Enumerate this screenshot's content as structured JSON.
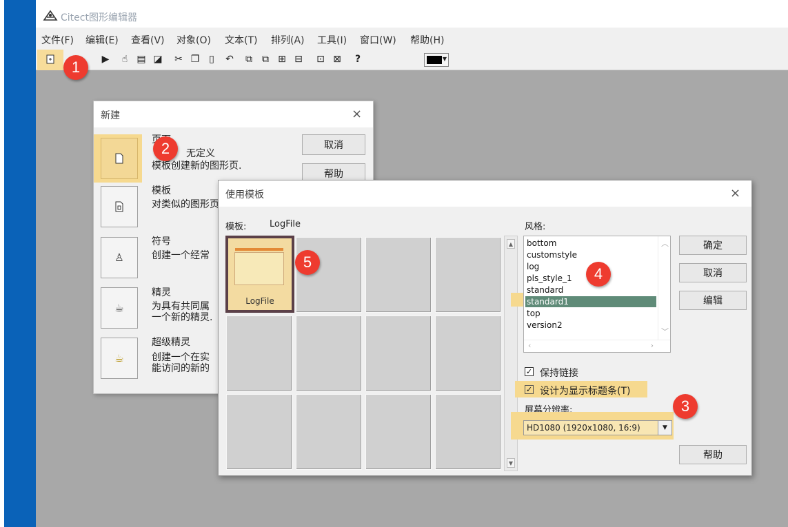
{
  "app": {
    "title": "Citect图形编辑器",
    "menu": [
      "文件(F)",
      "编辑(E)",
      "查看(V)",
      "对象(O)",
      "文本(T)",
      "排列(A)",
      "工具(I)",
      "窗口(W)",
      "帮助(H)"
    ],
    "toolbar_help_glyph": "?"
  },
  "badges": [
    "1",
    "2",
    "3",
    "4",
    "5"
  ],
  "new_dialog": {
    "title": "新建",
    "close": "×",
    "cancel_label": "取消",
    "help_label": "帮助",
    "items": [
      {
        "name": "页面",
        "desc1": "无定义",
        "desc2": "模板创建新的图形页."
      },
      {
        "name": "模板",
        "desc1": "对类似的图形页",
        "desc2": ""
      },
      {
        "name": "符号",
        "desc1": "创建一个经常",
        "desc2": ""
      },
      {
        "name": "精灵",
        "desc1": "为具有共同属",
        "desc2": "一个新的精灵."
      },
      {
        "name": "超级精灵",
        "desc1": "创建一个在实",
        "desc2": "能访问的新的"
      }
    ]
  },
  "template_dialog": {
    "title": "使用模板",
    "close": "×",
    "template_label": "模板:",
    "template_value": "LogFile",
    "selected_thumb_label": "LogFile",
    "style_label": "风格:",
    "styles": [
      "bottom",
      "customstyle",
      "log",
      "pls_style_1",
      "standard",
      "standard1",
      "top",
      "version2"
    ],
    "selected_style": "standard1",
    "ok_label": "确定",
    "cancel_label": "取消",
    "edit_label": "编辑",
    "help_label": "帮助",
    "keep_link_label": "保持链接",
    "keep_link_checked": true,
    "titlebar_label": "设计为显示标题条(T)",
    "titlebar_checked": true,
    "resolution_label": "屏幕分辨率:",
    "resolution_value": "HD1080 (1920x1080, 16:9)"
  },
  "colors": {
    "accent_highlight": "#f6d98f",
    "badge_red": "#ee3b2f",
    "blue_bar": "#0a62b8",
    "selection_green": "#5f8b78"
  }
}
